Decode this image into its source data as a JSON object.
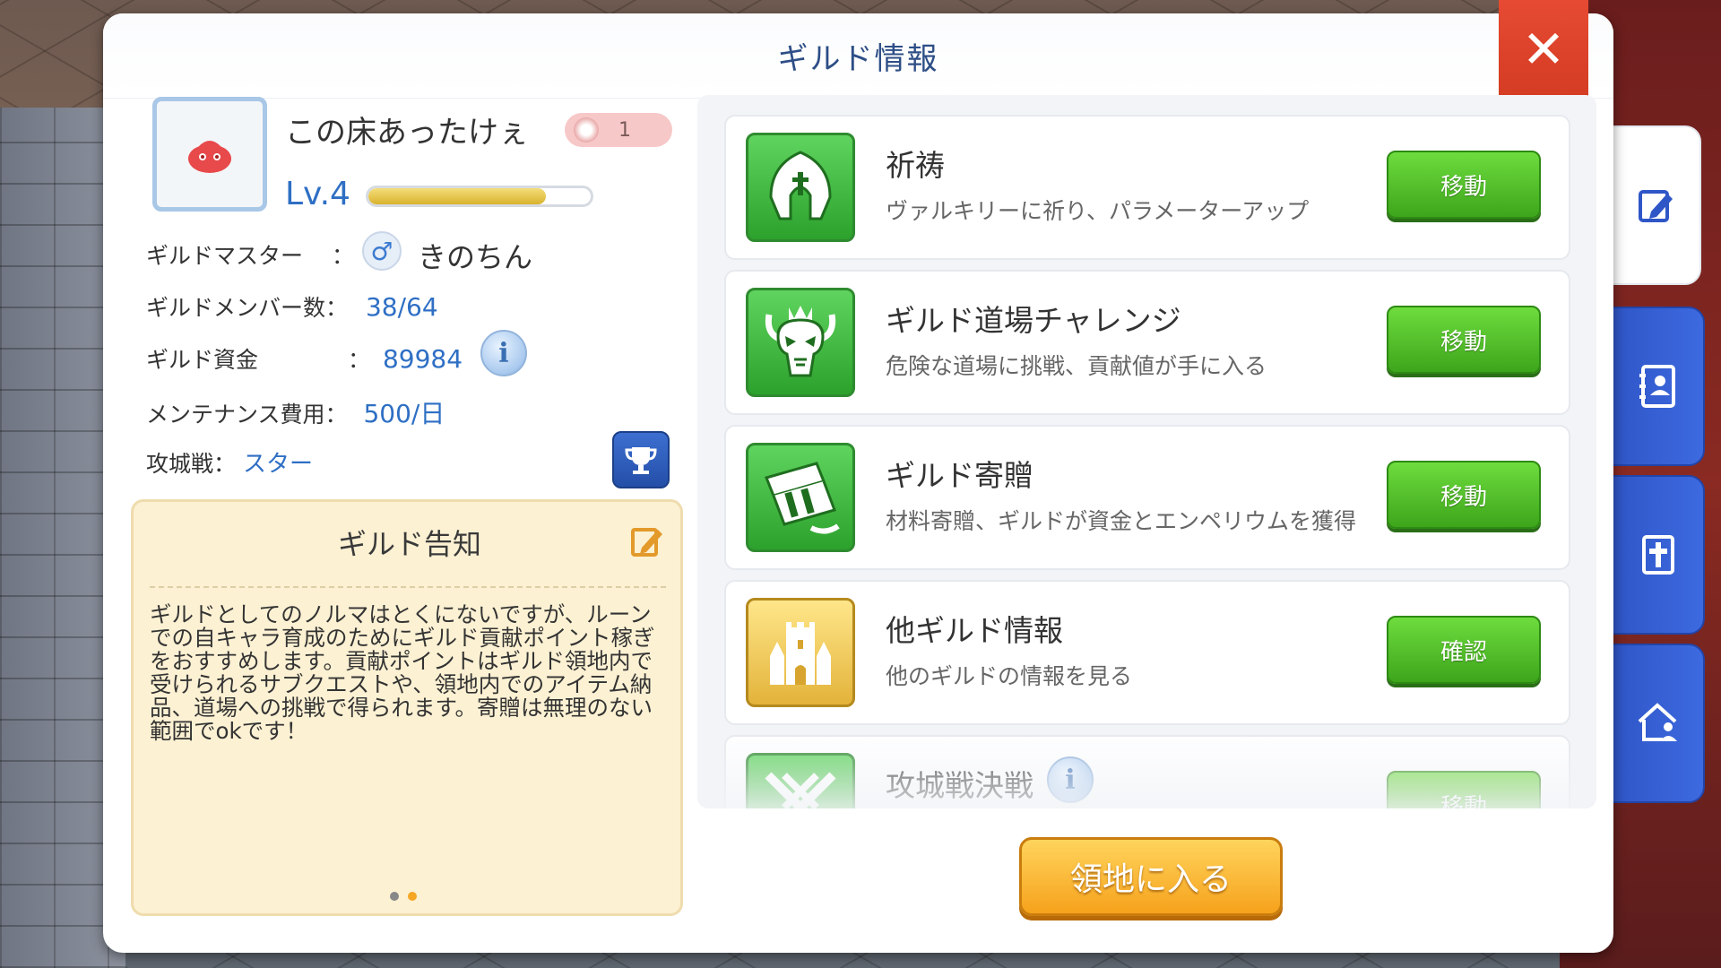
{
  "window": {
    "title": "ギルド情報"
  },
  "guild": {
    "name": "この床あったけぇ",
    "rank": "1",
    "level_label": "Lv.4",
    "level_progress": 0.8
  },
  "info": {
    "master_label": "ギルドマスター",
    "colon": "：",
    "master_name": "きのちん",
    "member_label": "ギルドメンバー数：",
    "member_count": "38/64",
    "fund_label": "ギルド資金",
    "fund_value": "89984",
    "maintenance_label": "メンテナンス費用：",
    "maintenance_value": "500/日",
    "siege_label": "攻城戦：",
    "siege_value": "スター"
  },
  "notice": {
    "title": "ギルド告知",
    "body": "ギルドとしてのノルマはとくにないですが、ルーンでの自キャラ育成のためにギルド貢献ポイント稼ぎをおすすめします。貢献ポイントはギルド領地内で受けられるサブクエストや、領地内でのアイテム納品、道場への挑戦で得られます。寄贈は無理のない範囲でokです！"
  },
  "items": [
    {
      "title": "祈祷",
      "desc": "ヴァルキリーに祈り、パラメーターアップ",
      "button": "移動",
      "icon": "helmet-icon"
    },
    {
      "title": "ギルド道場チャレンジ",
      "desc": "危険な道場に挑戦、貢献値が手に入る",
      "button": "移動",
      "icon": "demon-skull-icon"
    },
    {
      "title": "ギルド寄贈",
      "desc": "材料寄贈、ギルドが資金とエンペリウムを獲得",
      "button": "移動",
      "icon": "donation-icon"
    },
    {
      "title": "他ギルド情報",
      "desc": "他のギルドの情報を見る",
      "button": "確認",
      "icon": "castle-icon"
    },
    {
      "title": "攻城戦決戦",
      "desc": "",
      "button": "移動",
      "icon": "crossed-swords-icon"
    }
  ],
  "enter_button": "領地に入る",
  "colors": {
    "title_blue": "#2d4e86",
    "value_blue": "#2e6fc4",
    "green_button": "#3da51b",
    "orange_button": "#f6a21c",
    "close_red": "#d23a22",
    "tab_blue": "#2f56c7"
  }
}
